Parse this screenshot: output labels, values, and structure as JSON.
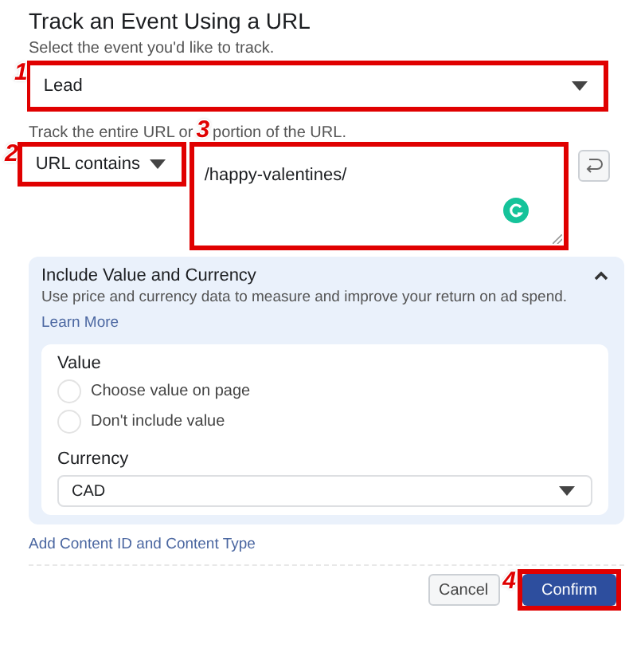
{
  "title": "Track an Event Using a URL",
  "event_label": "Select the event you'd like to track.",
  "event_select": {
    "value": "Lead",
    "marker": "1"
  },
  "url_label": {
    "before": "Track the entire URL or",
    "after": "portion of the URL."
  },
  "match_select": {
    "value": "URL contains",
    "marker": "2"
  },
  "url_field": {
    "value": "/happy-valentines/",
    "marker": "3"
  },
  "value_section": {
    "title": "Include Value and Currency",
    "expanded": true,
    "description": "Use price and currency data to measure and improve your return on ad spend.",
    "link": "Learn More",
    "value_heading": "Value",
    "options": [
      {
        "label": "Choose value on page",
        "selected": false
      },
      {
        "label": "Don't include value",
        "selected": false
      }
    ],
    "currency_heading": "Currency",
    "currency_select": {
      "value": "CAD"
    }
  },
  "content_link": "Add Content ID and Content Type",
  "buttons": [
    {
      "label": "Cancel",
      "kind": "secondary"
    },
    {
      "label": "Confirm",
      "kind": "primary",
      "marker": "4"
    }
  ]
}
